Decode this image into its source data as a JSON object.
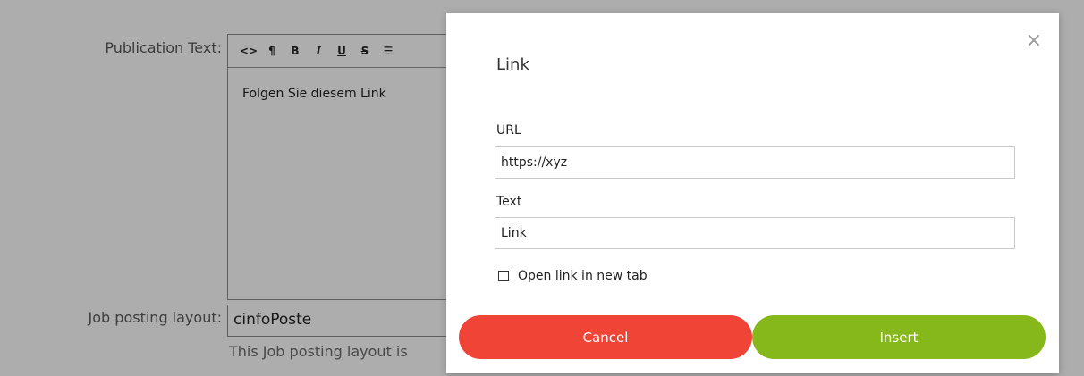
{
  "form": {
    "publication_label": "Publication Text:",
    "job_layout_label": "Job posting layout:",
    "job_layout_value": "cinfoPoste",
    "job_layout_hint": "This Job posting layout is"
  },
  "editor": {
    "toolbar": {
      "code": "<>",
      "paragraph": "¶",
      "bold": "B",
      "italic": "I",
      "underline": "U",
      "strike": "S",
      "list": "☰"
    },
    "content": "Folgen Sie diesem Link"
  },
  "modal": {
    "title": "Link",
    "close_glyph": "×",
    "url_label": "URL",
    "url_value": "https://xyz",
    "text_label": "Text",
    "text_value": "Link",
    "new_tab_label": "Open link in new tab",
    "new_tab_checked": false,
    "cancel_label": "Cancel",
    "insert_label": "Insert"
  },
  "colors": {
    "cancel": "#f04436",
    "insert": "#86b81c"
  }
}
